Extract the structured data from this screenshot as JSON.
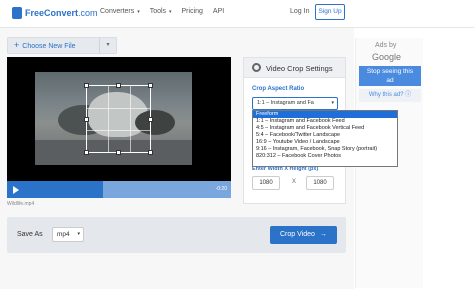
{
  "header": {
    "logo_bold": "FreeConvert",
    "logo_light": ".com",
    "nav": [
      {
        "label": "Converters",
        "caret": "▾"
      },
      {
        "label": "Tools",
        "caret": "▾"
      },
      {
        "label": "Pricing",
        "caret": ""
      },
      {
        "label": "API",
        "caret": ""
      }
    ],
    "login": "Log In",
    "signup": "Sign Up"
  },
  "upload": {
    "plus": "+",
    "choose_label": "Choose New File",
    "caret": "▾"
  },
  "player": {
    "time": "-0:20",
    "filename": "Wildlife.mp4",
    "progress_fraction": 0.43
  },
  "settings": {
    "title": "Video Crop Settings",
    "ratio_label": "Crop Aspect Ratio",
    "ratio_selected": "1:1 – Instagram and Fa",
    "caret": "▾",
    "wh_label": "Enter Width X Height (px)",
    "width": "1080",
    "separator": "X",
    "height": "1080",
    "options": [
      "Freeform",
      "1:1 – Instagram and Facebook Feed",
      "4:5 – Instagram and Facebook Vertical Feed",
      "5:4 – Facebook/Twitter Landscape",
      "16:9 – Youtube Video / Landscape",
      "9:16 – Instagram, Facebook, Snap Story (portrait)",
      "820:312 – Facebook Cover Photos"
    ]
  },
  "output": {
    "save_as": "Save As",
    "format": "mp4",
    "caret": "▾",
    "crop_button": "Crop Video",
    "arrow": "→"
  },
  "ad": {
    "ads_by": "Ads by",
    "google": "Google",
    "stop_line1": "Stop seeing this",
    "stop_line2": "ad",
    "why": "Why this ad? ⓘ"
  },
  "colors": {
    "accent": "#2b72c9",
    "dropdown_highlight": "#1e6fd9"
  }
}
